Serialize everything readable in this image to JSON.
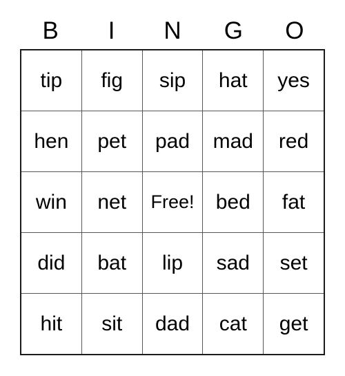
{
  "card": {
    "headers": [
      "B",
      "I",
      "N",
      "G",
      "O"
    ],
    "rows": [
      [
        "tip",
        "fig",
        "sip",
        "hat",
        "yes"
      ],
      [
        "hen",
        "pet",
        "pad",
        "mad",
        "red"
      ],
      [
        "win",
        "net",
        "Free!",
        "bed",
        "fat"
      ],
      [
        "did",
        "bat",
        "lip",
        "sad",
        "set"
      ],
      [
        "hit",
        "sit",
        "dad",
        "cat",
        "get"
      ]
    ],
    "free_space": {
      "row": 2,
      "col": 2,
      "label": "Free!"
    },
    "colors": {
      "text": "#000000",
      "background": "#ffffff",
      "outer_border": "#1a1a1a",
      "inner_border": "#555555"
    }
  }
}
